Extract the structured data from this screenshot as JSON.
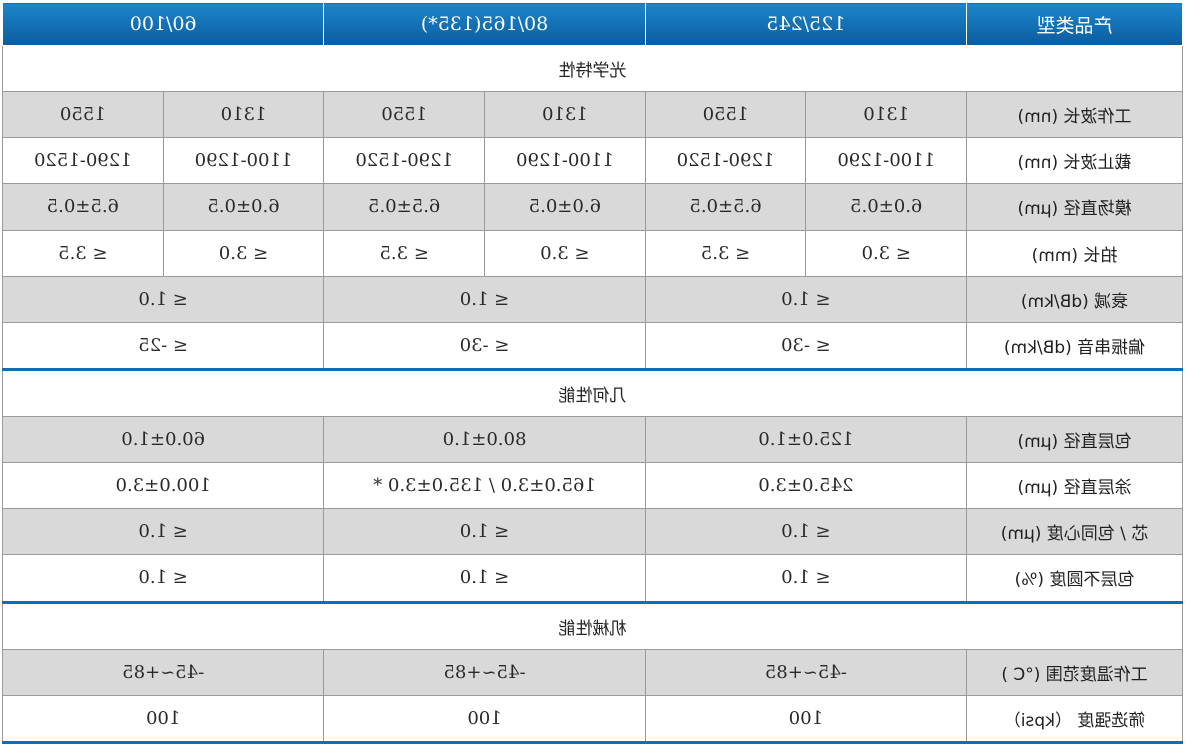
{
  "header": {
    "col_label": "产品类型",
    "types": [
      "125/245",
      "80/165(135*)",
      "60/100"
    ]
  },
  "sections": {
    "optical": "光学特性",
    "geometric": "几何性能",
    "mechanical": "机械性能"
  },
  "optical_rows": {
    "wavelength": {
      "label": "工作波长 (nm)",
      "values": [
        "1310",
        "1550",
        "1310",
        "1550",
        "1310",
        "1550"
      ]
    },
    "cutoff": {
      "label": "截止波长 (nm)",
      "values": [
        "1100-1290",
        "1290-1520",
        "1100-1290",
        "1290-1520",
        "1100-1290",
        "1290-1520"
      ]
    },
    "mode_field": {
      "label": "模场直径 (μm)",
      "values": [
        "6.0±0.5",
        "6.5±0.5",
        "6.0±0.5",
        "6.5±0.5",
        "6.0±0.5",
        "6.5±0.5"
      ]
    },
    "beat_length": {
      "label": "拍长 (mm)",
      "values": [
        "≤ 3.0",
        "≤ 3.5",
        "≤ 3.0",
        "≤ 3.5",
        "≤ 3.0",
        "≤ 3.5"
      ]
    },
    "attenuation": {
      "label": "衰减 (dB/km)",
      "values": [
        "≤ 1.0",
        "≤ 1.0",
        "≤ 1.0"
      ]
    },
    "crosstalk": {
      "label": "偏振串音 (dB/km)",
      "values": [
        "≤ -30",
        "≤ -30",
        "≤ -25"
      ]
    }
  },
  "geometric_rows": {
    "cladding_diameter": {
      "label": "包层直径 (μm)",
      "values": [
        "125.0±1.0",
        "80.0±1.0",
        "60.0±1.0"
      ]
    },
    "coating_diameter": {
      "label": "涂层直径 (μm)",
      "values": [
        "245.0±3.0",
        "165.0±3.0 / 135.0±3.0 *",
        "100.0±3.0"
      ]
    },
    "concentricity": {
      "label": "芯 / 包同心度 (μm)",
      "values": [
        "≤ 1.0",
        "≤ 1.0",
        "≤ 1.0"
      ]
    },
    "non_circularity": {
      "label": "包层不圆度 (%)",
      "values": [
        "≤ 1.0",
        "≤ 1.0",
        "≤ 1.0"
      ]
    }
  },
  "mechanical_rows": {
    "temperature": {
      "label": "工作温度范围 (°C )",
      "values": [
        "-45~+85",
        "-45~+85",
        "-45~+85"
      ]
    },
    "proof_test": {
      "label": "筛选强度 （kpsi）",
      "values": [
        "100",
        "100",
        "100"
      ]
    }
  }
}
